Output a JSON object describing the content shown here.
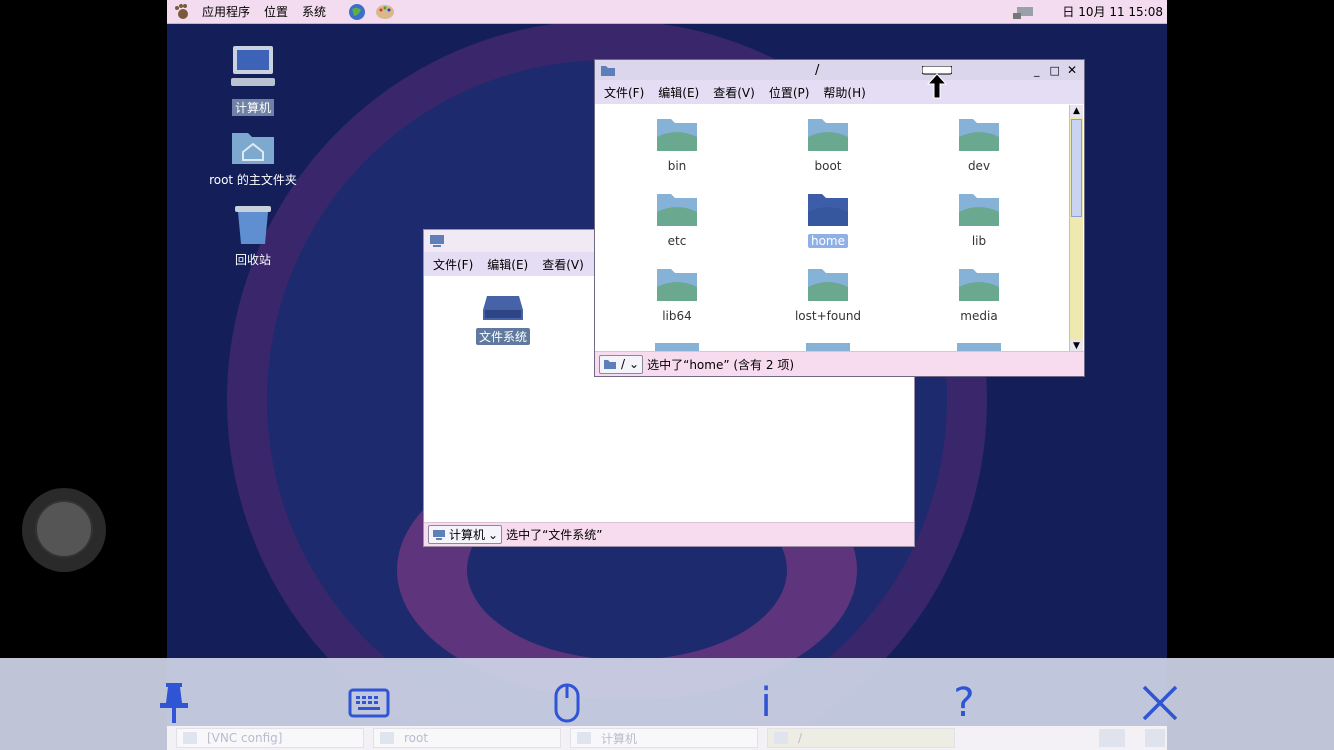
{
  "top_panel": {
    "menus": [
      "应用程序",
      "位置",
      "系统"
    ],
    "clock": "日 10月 11 15:08"
  },
  "desktop_icons": [
    {
      "label": "计算机",
      "icon": "computer-icon"
    },
    {
      "label": "root 的主文件夹",
      "icon": "home-folder-icon"
    },
    {
      "label": "回收站",
      "icon": "trash-icon"
    }
  ],
  "root_window": {
    "title": "/",
    "menus": [
      "文件(F)",
      "编辑(E)",
      "查看(V)",
      "位置(P)",
      "帮助(H)"
    ],
    "folders": [
      "bin",
      "boot",
      "dev",
      "etc",
      "home",
      "lib",
      "lib64",
      "lost+found",
      "media"
    ],
    "selected": "home",
    "location": "/",
    "status": "选中了“home” (含有 2 项)"
  },
  "computer_window": {
    "menus": [
      "文件(F)",
      "编辑(E)",
      "查看(V)"
    ],
    "item": "文件系统",
    "location": "计算机",
    "status": "选中了“文件系统”"
  },
  "toolbar": {
    "icons": [
      "pin-icon",
      "keyboard-icon",
      "mouse-icon",
      "info-icon",
      "help-icon",
      "close-icon"
    ],
    "info_label": "i",
    "help_label": "?"
  },
  "taskbar": {
    "items": [
      "[VNC config]",
      "root",
      "计算机",
      "/"
    ]
  },
  "colors": {
    "desktop": "#141f5a",
    "panel": "#f4dcf0",
    "accent": "#2f55d4",
    "selection": "#8fb0e6"
  }
}
